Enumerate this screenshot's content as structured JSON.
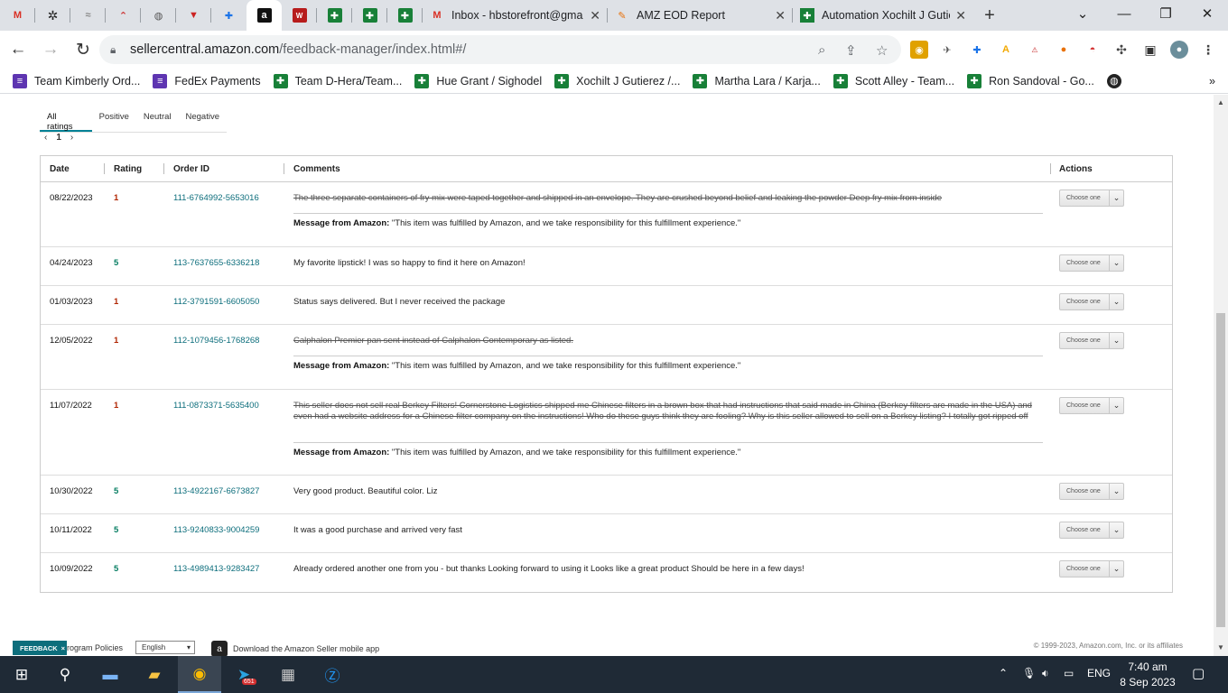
{
  "browser": {
    "tabs": [
      {
        "title": "Inbox - hbstorefront@gma",
        "icon": "gmail-icon"
      },
      {
        "title": "AMZ EOD Report",
        "icon": "pen-icon"
      },
      {
        "title": "Automation Xochilt J Gutie",
        "icon": "sheets-icon"
      }
    ],
    "new_tab": "+",
    "url_main": "sellercentral.amazon.com",
    "url_rest": "/feedback-manager/index.html#/",
    "bookmarks": [
      {
        "label": "Team Kimberly Ord...",
        "color": "#5e35b1"
      },
      {
        "label": "FedEx Payments",
        "color": "#5e35b1"
      },
      {
        "label": "Team D-Hera/Team...",
        "color": "#188038"
      },
      {
        "label": "Hue Grant / Sighodel",
        "color": "#188038"
      },
      {
        "label": "Xochilt J Gutierez /...",
        "color": "#188038"
      },
      {
        "label": "Martha Lara / Karja...",
        "color": "#188038"
      },
      {
        "label": "Scott Alley - Team...",
        "color": "#188038"
      },
      {
        "label": "Ron Sandoval - Go...",
        "color": "#188038"
      }
    ]
  },
  "filters": {
    "tabs": [
      "All ratings",
      "Positive",
      "Neutral",
      "Negative"
    ],
    "page": "1"
  },
  "table": {
    "headers": {
      "date": "Date",
      "rating": "Rating",
      "order_id": "Order ID",
      "comments": "Comments",
      "actions": "Actions"
    },
    "action_label": "Choose one",
    "message_label": "Message from Amazon:",
    "message_text": "\"This item was fulfilled by Amazon, and we take responsibility for this fulfillment experience.\"",
    "rows": [
      {
        "date": "08/22/2023",
        "rating": "1",
        "order_id": "111-6764992-5653016",
        "comment": "The three separate containers of fry mix were taped together and shipped in an envelope. They are crushed beyond belief and leaking the powder Deep fry mix from inside"
      },
      {
        "date": "04/24/2023",
        "rating": "5",
        "order_id": "113-7637655-6336218",
        "comment": "My favorite lipstick! I was so happy to find it here on Amazon!"
      },
      {
        "date": "01/03/2023",
        "rating": "1",
        "order_id": "112-3791591-6605050",
        "comment": "Status says delivered. But I never received the package"
      },
      {
        "date": "12/05/2022",
        "rating": "1",
        "order_id": "112-1079456-1768268",
        "comment": "Calphalon Premier pan sent instead of Calphalon Contemporary as listed."
      },
      {
        "date": "11/07/2022",
        "rating": "1",
        "order_id": "111-0873371-5635400",
        "comment": "This seller does not sell real Berkey Filters! Cornerstone Logistics shipped me Chinese filters in a brown box that had instructions that said made in China (Berkey filters are made in the USA) and even had a website address for a Chinese filter company on the instructions! Who do these guys think they are fooling? Why is this seller allowed to sell on a Berkey listing? I totally got ripped off"
      },
      {
        "date": "10/30/2022",
        "rating": "5",
        "order_id": "113-4922167-6673827",
        "comment": "Very good product. Beautiful color. Liz"
      },
      {
        "date": "10/11/2022",
        "rating": "5",
        "order_id": "113-9240833-9004259",
        "comment": "It was a good purchase and arrived very fast"
      },
      {
        "date": "10/09/2022",
        "rating": "5",
        "order_id": "113-4989413-9283427",
        "comment": "Already ordered another one from you - but thanks Looking forward to using it Looks like a great product Should be here in a few days!"
      }
    ]
  },
  "footer": {
    "feedback": "FEEDBACK",
    "feedback_close": "×",
    "policies": "rogram Policies",
    "language": "English",
    "app_text": "Download the Amazon Seller mobile app",
    "copyright": "© 1999-2023, Amazon.com, Inc. or its affiliates"
  },
  "taskbar": {
    "lang": "ENG",
    "time": "7:40 am",
    "date": "8 Sep 2023",
    "telegram_badge": "651"
  }
}
